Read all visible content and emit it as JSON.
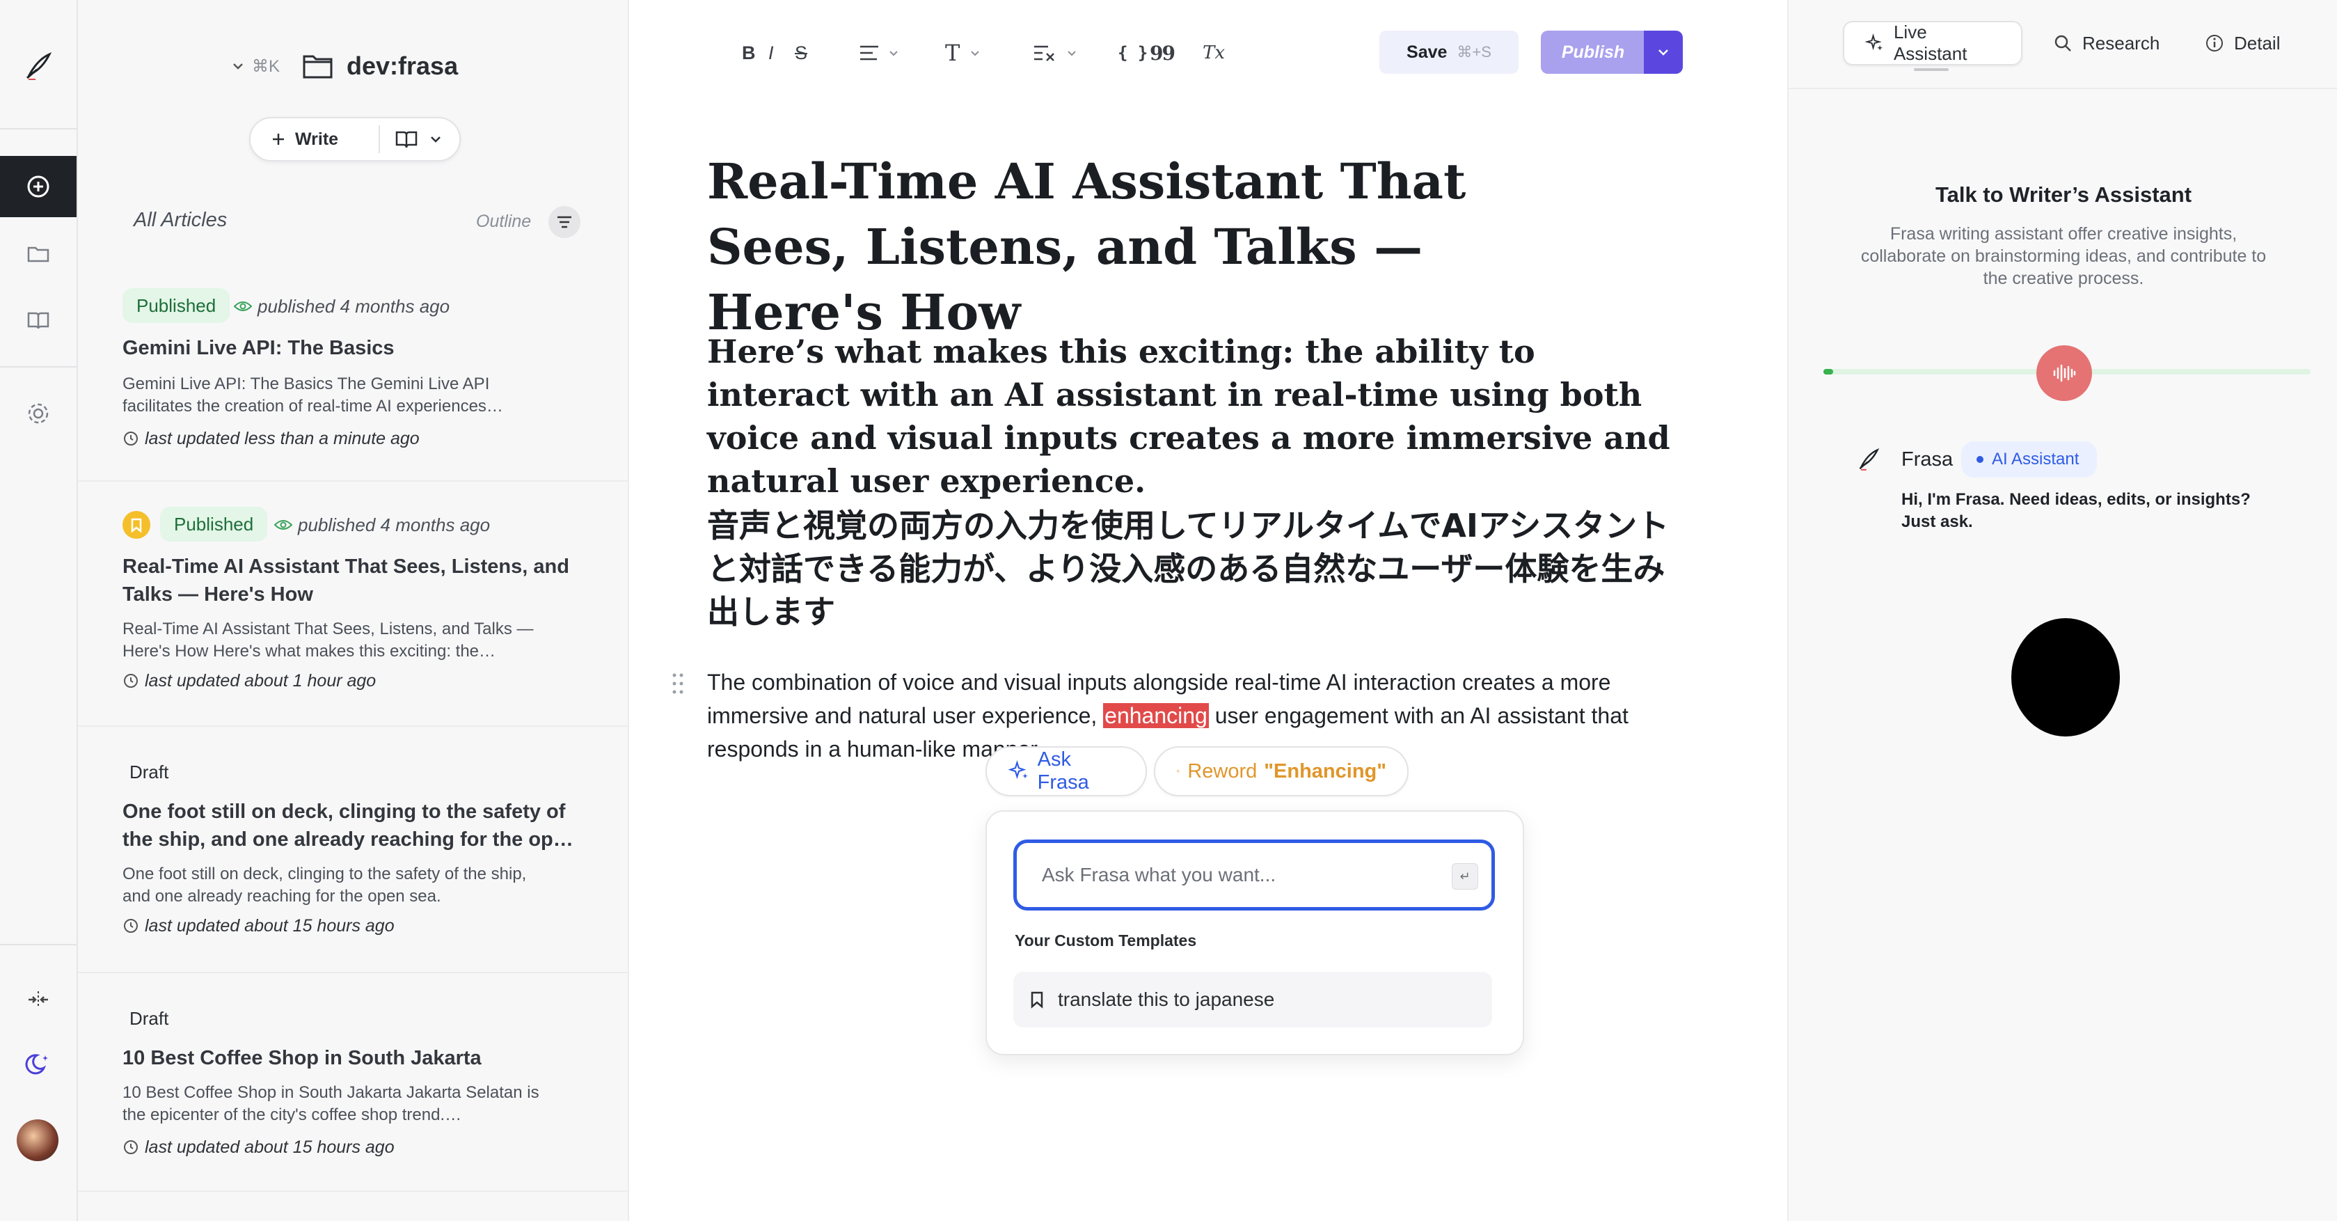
{
  "rail": {
    "items": [
      "add-icon",
      "folder-icon",
      "book-icon",
      "settings-icon"
    ],
    "bottom": [
      "expand-icon",
      "moon-icon",
      "avatar"
    ]
  },
  "list_header": {
    "shortcut": "⌘K",
    "workspace": "dev:frasa",
    "write_label": "Write",
    "all_articles": "All Articles",
    "outline": "Outline"
  },
  "articles": [
    {
      "status": "Published",
      "meta": "published 4 months ago",
      "title": "Gemini Live API: The Basics",
      "excerpt": "Gemini Live API: The Basics The Gemini Live API facilitates the creation of real-time AI experiences…",
      "updated": "last updated less than a minute ago"
    },
    {
      "status": "Published",
      "meta": "published 4 months ago",
      "title": "Real-Time AI Assistant That Sees, Listens, and Talks — Here's How",
      "excerpt": "Real-Time AI Assistant That Sees, Listens, and Talks — Here's How Here's what makes this exciting: the…",
      "updated": "last updated about 1 hour ago"
    },
    {
      "status": "Draft",
      "title": "One foot still on deck, clinging to the safety of the ship, and one already reaching for the op…",
      "excerpt": "One foot still on deck, clinging to the safety of the ship, and one already reaching for the open sea.",
      "updated": "last updated about 15 hours ago"
    },
    {
      "status": "Draft",
      "title": "10 Best Coffee Shop in South Jakarta",
      "excerpt": "10 Best Coffee Shop in South Jakarta Jakarta Selatan is the epicenter of the city's coffee shop trend.…",
      "updated": "last updated about 15 hours ago"
    }
  ],
  "toolbar": {
    "bold": "B",
    "italic": "I",
    "strike": "S",
    "text_type": "T",
    "code": "{ }",
    "quote": "99",
    "clear": "Tx",
    "save_label": "Save",
    "save_shortcut": "⌘+S",
    "publish_label": "Publish"
  },
  "document": {
    "title": "Real-Time AI Assistant That Sees, Listens, and Talks — Here's How",
    "heading_en": "Here’s what makes this exciting: the ability to interact with an AI assistant in real-time using both voice and visual inputs creates a more immersive and natural user experience.",
    "heading_jp": "音声と視覚の両方の入力を使用してリアルタイムでAIアシスタントと対話できる能力が、より没入感のある自然なユーザー体験を生み出します",
    "para_before": "The combination of voice and visual inputs alongside real-time AI interaction creates a more immersive and natural user experience, ",
    "para_highlight": "enhancing",
    "para_after": " user engagement with an AI assistant that responds in a human-like manner."
  },
  "ask_popup": {
    "ask_label": "Ask Frasa",
    "reword_label": "Reword",
    "reword_word": "\"Enhancing\"",
    "placeholder": "Ask Frasa what you want...",
    "enter_key": "↵",
    "templates_heading": "Your Custom Templates",
    "template_item": "translate this to japanese"
  },
  "assistant": {
    "tabs": [
      "Live Assistant",
      "Research",
      "Detail"
    ],
    "title": "Talk to Writer’s Assistant",
    "description": "Frasa writing assistant offer creative insights, collaborate on brainstorming ideas, and contribute to the creative process.",
    "sender": "Frasa",
    "sender_badge": "AI Assistant",
    "message": "Hi, I'm Frasa. Need ideas, edits, or insights? Just ask.",
    "progress": 0.02
  },
  "colors": {
    "accent": "#2f5be5",
    "publish": "#a9a1ee",
    "publish_dark": "#5b47e0",
    "highlight": "#e24a4a",
    "published_bg": "#e3f6e7",
    "mic": "#e57373",
    "reword": "#e0962a"
  }
}
